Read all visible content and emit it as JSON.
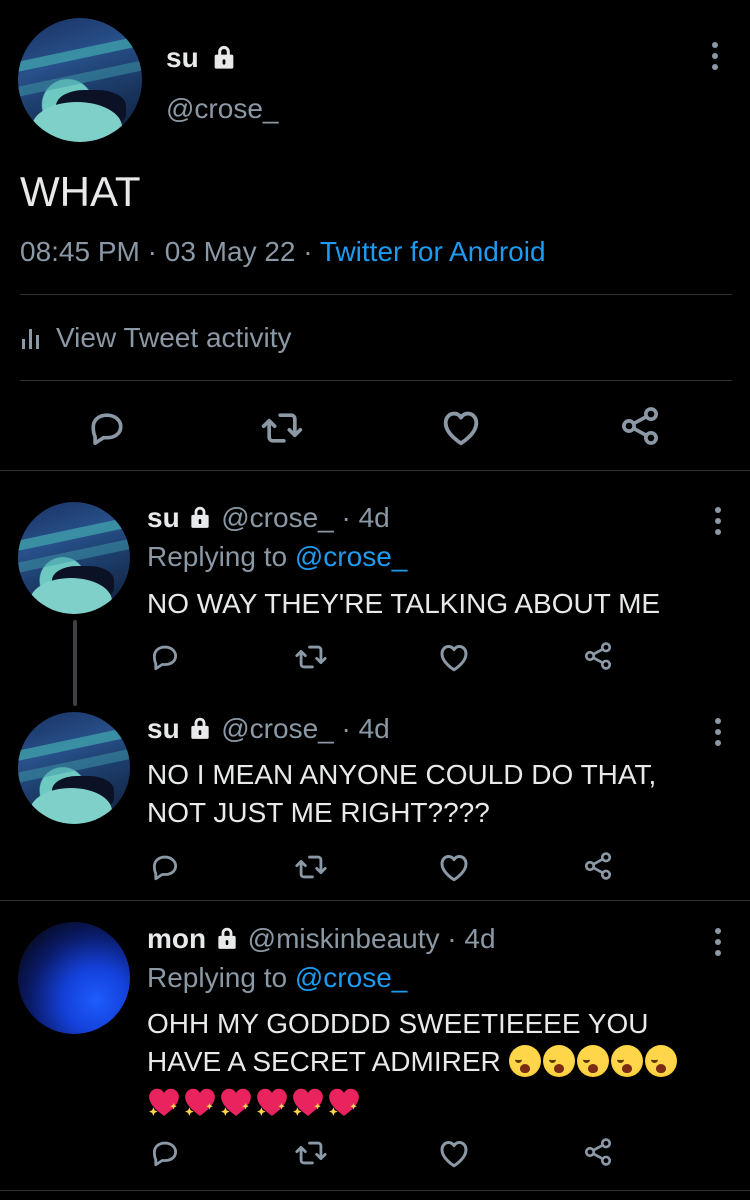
{
  "tweet": {
    "display_name": "su",
    "handle": "@crose_",
    "text": "WHAT",
    "time": "08:45 PM",
    "sep1": "·",
    "date": "03 May 22",
    "sep2": "·",
    "source": "Twitter for Android",
    "activity_label": "View Tweet activity"
  },
  "replies": [
    {
      "display_name": "su",
      "handle": "@crose_",
      "age": "· 4d",
      "replying_prefix": "Replying to",
      "replying_to": "@crose_",
      "text": "NO WAY THEY'RE TALKING ABOUT ME"
    },
    {
      "display_name": "su",
      "handle": "@crose_",
      "age": "· 4d",
      "text_line1": "NO I MEAN ANYONE COULD DO THAT,",
      "text_line2": "NOT JUST ME RIGHT????"
    },
    {
      "display_name": "mon",
      "handle": "@miskinbeauty",
      "age": "· 4d",
      "replying_prefix": "Replying to",
      "replying_to": "@crose_",
      "text_line1": "OHH MY GODDDD SWEETIEEEE YOU",
      "text_line2": "HAVE A SECRET ADMIRER",
      "emoji_line2": [
        "loudly-crying-face",
        "loudly-crying-face",
        "loudly-crying-face",
        "loudly-crying-face",
        "loudly-crying-face"
      ],
      "emoji_line3": [
        "sparkling-heart",
        "sparkling-heart",
        "sparkling-heart",
        "sparkling-heart",
        "sparkling-heart",
        "sparkling-heart"
      ]
    }
  ],
  "icons": {
    "reply": "reply-icon",
    "retweet": "retweet-icon",
    "like": "like-icon",
    "share": "share-icon",
    "more": "more-icon",
    "lock": "lock-icon",
    "activity": "bar-chart-icon"
  },
  "colors": {
    "background": "#000000",
    "text": "#e7e9ea",
    "secondary": "#8b98a5",
    "link": "#1d9bf0",
    "divider": "#2f3336"
  }
}
